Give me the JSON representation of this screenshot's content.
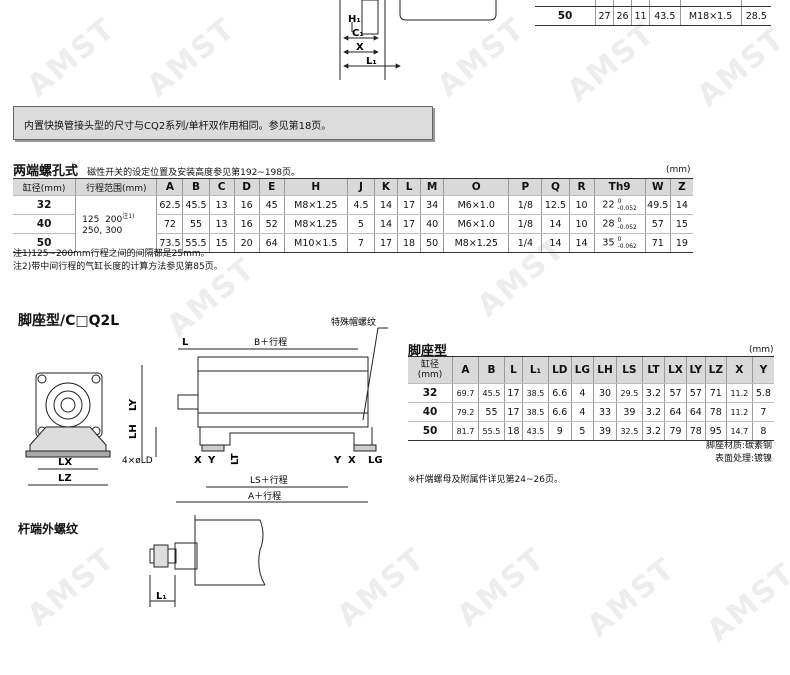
{
  "top_diagram": {
    "labels": {
      "h1": "H₁",
      "c1": "C₁",
      "x": "X",
      "l1": "L₁"
    }
  },
  "top_table_tail": {
    "partial_row_label": "40",
    "partial_row_values": [
      "",
      "",
      "",
      "",
      ""
    ],
    "row": {
      "bore": "50",
      "values": [
        "27",
        "26",
        "11",
        "43.5",
        "M18×1.5",
        "28.5"
      ]
    }
  },
  "notice_box": {
    "text": "内置快换管接头型的尺寸与CQ2系列/单杆双作用相同。参见第18页。"
  },
  "thru_hole": {
    "title": "两端螺孔式",
    "subtitle": "磁性开关的设定位置及安装高度参见第192~198页。",
    "unit": "(mm)",
    "headers": [
      "缸径(mm)",
      "行程范围(mm)",
      "A",
      "B",
      "C",
      "D",
      "E",
      "H",
      "J",
      "K",
      "L",
      "M",
      "O",
      "P",
      "Q",
      "R",
      "Th9",
      "W",
      "Z"
    ],
    "stroke_range": {
      "line1": "125  200",
      "sup": "注1)",
      "line2": "250, 300"
    },
    "rows": [
      {
        "bore": "32",
        "A": "62.5",
        "B": "45.5",
        "C": "13",
        "D": "16",
        "E": "45",
        "H": "M8×1.25",
        "J": "4.5",
        "K": "14",
        "L": "17",
        "M": "34",
        "O": "M6×1.0",
        "P": "1/8",
        "Q": "12.5",
        "R": "10",
        "Th9": "22",
        "Th9_tol_top": "0",
        "Th9_tol_bot": "-0.052",
        "W": "49.5",
        "Z": "14"
      },
      {
        "bore": "40",
        "A": "72",
        "B": "55",
        "C": "13",
        "D": "16",
        "E": "52",
        "H": "M8×1.25",
        "J": "5",
        "K": "14",
        "L": "17",
        "M": "40",
        "O": "M6×1.0",
        "P": "1/8",
        "Q": "14",
        "R": "10",
        "Th9": "28",
        "Th9_tol_top": "0",
        "Th9_tol_bot": "-0.052",
        "W": "57",
        "Z": "15"
      },
      {
        "bore": "50",
        "A": "73.5",
        "B": "55.5",
        "C": "15",
        "D": "20",
        "E": "64",
        "H": "M10×1.5",
        "J": "7",
        "K": "17",
        "L": "18",
        "M": "50",
        "O": "M8×1.25",
        "P": "1/4",
        "Q": "14",
        "R": "14",
        "Th9": "35",
        "Th9_tol_top": "0",
        "Th9_tol_bot": "-0.062",
        "W": "71",
        "Z": "19"
      }
    ],
    "notes": [
      "注1)125~200mm行程之间的间隔都是25mm。",
      "注2)带中间行程的气缸长度的计算方法参见第85页。"
    ]
  },
  "foot": {
    "section_title": "脚座型/C□Q2L",
    "table_title": "脚座型",
    "unit": "(mm)",
    "headers": [
      "缸径\n(mm)",
      "A",
      "B",
      "L",
      "L₁",
      "LD",
      "LG",
      "LH",
      "LS",
      "LT",
      "LX",
      "LY",
      "LZ",
      "X",
      "Y"
    ],
    "header_bore_line1": "缸径",
    "header_bore_line2": "(mm)",
    "rows": [
      {
        "bore": "32",
        "values": [
          "69.7",
          "45.5",
          "17",
          "38.5",
          "6.6",
          "4",
          "30",
          "29.5",
          "3.2",
          "57",
          "57",
          "71",
          "11.2",
          "5.8"
        ]
      },
      {
        "bore": "40",
        "values": [
          "79.2",
          "55",
          "17",
          "38.5",
          "6.6",
          "4",
          "33",
          "39",
          "3.2",
          "64",
          "64",
          "78",
          "11.2",
          "7"
        ]
      },
      {
        "bore": "50",
        "values": [
          "81.7",
          "55.5",
          "18",
          "43.5",
          "9",
          "5",
          "39",
          "32.5",
          "3.2",
          "79",
          "78",
          "95",
          "14.7",
          "8"
        ]
      }
    ],
    "material_line1": "脚座材质:碳素钢",
    "material_line2": "表面处理:镀镍",
    "footnote": "※杆端螺母及附属件详见第24~26页。",
    "diagram_labels": {
      "special_cap_nut": "特殊帽螺纹",
      "L": "L",
      "B_stroke": "B＋行程",
      "LY": "LY",
      "LH": "LH",
      "LT": "LT",
      "LX": "LX",
      "LZ": "LZ",
      "hole": "4×øLD",
      "X": "X",
      "Y": "Y",
      "LS_stroke": "LS＋行程",
      "A_stroke": "A＋行程",
      "LG": "LG"
    }
  },
  "rod_end": {
    "title": "杆端外螺纹",
    "l1": "L₁"
  },
  "watermark": {
    "text": "AMST"
  }
}
